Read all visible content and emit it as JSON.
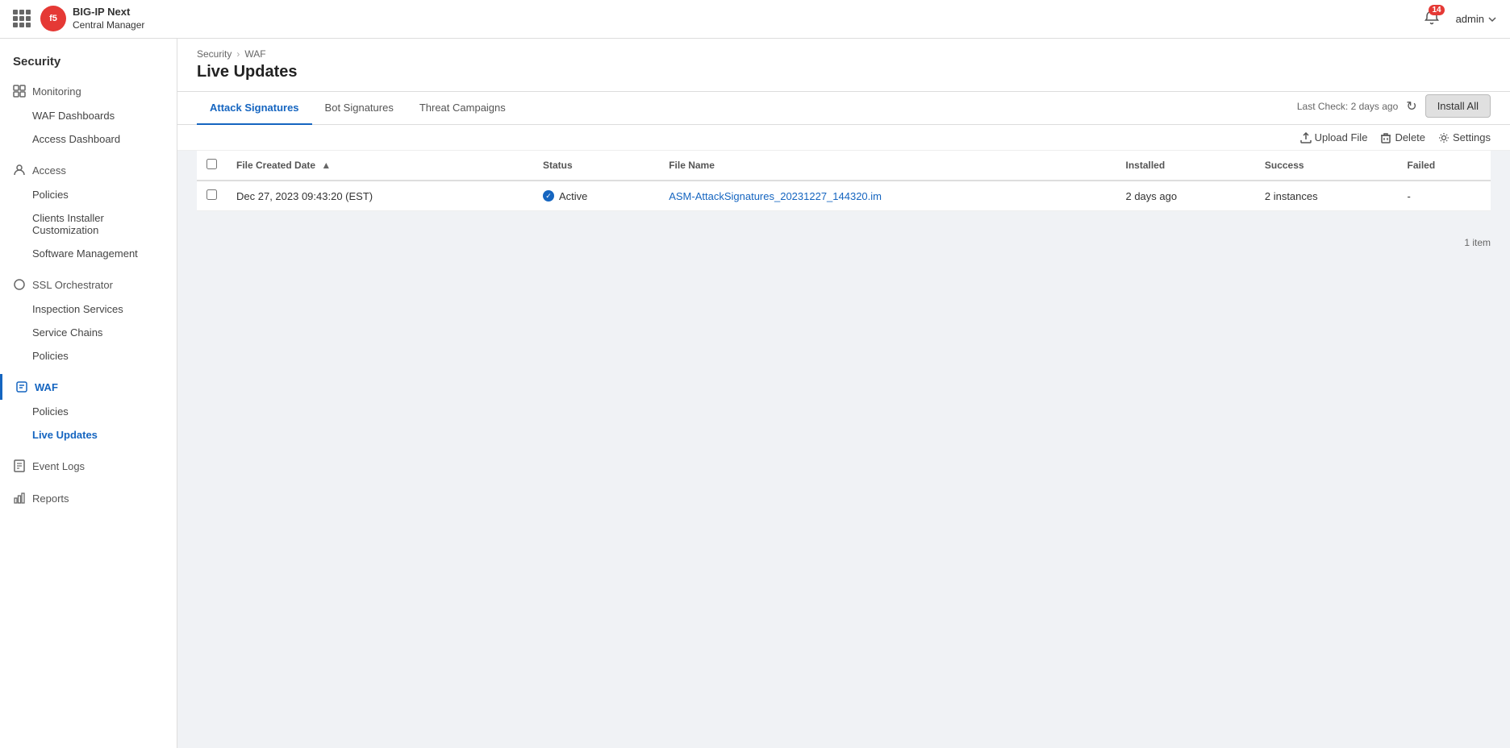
{
  "app": {
    "logo_initials": "f5",
    "product_line": "BIG-IP Next",
    "product_name": "Central Manager"
  },
  "topbar": {
    "notification_count": "14",
    "admin_label": "admin"
  },
  "sidebar": {
    "section_title": "Security",
    "groups": [
      {
        "id": "monitoring",
        "label": "Monitoring",
        "icon": "grid-icon",
        "items": [
          {
            "id": "waf-dashboards",
            "label": "WAF Dashboards"
          },
          {
            "id": "access-dashboard",
            "label": "Access Dashboard"
          }
        ]
      },
      {
        "id": "access",
        "label": "Access",
        "icon": "person-icon",
        "items": [
          {
            "id": "policies-access",
            "label": "Policies"
          },
          {
            "id": "clients-installer",
            "label": "Clients Installer Customization"
          },
          {
            "id": "software-mgmt",
            "label": "Software Management"
          }
        ]
      },
      {
        "id": "ssl-orchestrator",
        "label": "SSL Orchestrator",
        "icon": "circle-icon",
        "items": [
          {
            "id": "inspection-services",
            "label": "Inspection Services"
          },
          {
            "id": "service-chains",
            "label": "Service Chains"
          },
          {
            "id": "policies-ssl",
            "label": "Policies"
          }
        ]
      },
      {
        "id": "waf",
        "label": "WAF",
        "icon": "shield-icon",
        "active": true,
        "items": [
          {
            "id": "waf-policies",
            "label": "Policies"
          },
          {
            "id": "live-updates",
            "label": "Live Updates",
            "active": true
          }
        ]
      },
      {
        "id": "event-logs",
        "label": "Event Logs",
        "icon": "log-icon",
        "items": []
      },
      {
        "id": "reports",
        "label": "Reports",
        "icon": "report-icon",
        "items": []
      }
    ]
  },
  "breadcrumb": {
    "items": [
      "Security",
      "WAF"
    ]
  },
  "page_title": "Live Updates",
  "tabs": [
    {
      "id": "attack-signatures",
      "label": "Attack Signatures",
      "active": true
    },
    {
      "id": "bot-signatures",
      "label": "Bot Signatures"
    },
    {
      "id": "threat-campaigns",
      "label": "Threat Campaigns"
    }
  ],
  "toolbar": {
    "last_check_label": "Last Check:",
    "last_check_value": "2 days ago",
    "install_all_label": "Install All"
  },
  "actions": {
    "upload_file_label": "Upload File",
    "delete_label": "Delete",
    "settings_label": "Settings"
  },
  "table": {
    "columns": [
      {
        "id": "file-created-date",
        "label": "File Created Date",
        "sortable": true
      },
      {
        "id": "status",
        "label": "Status"
      },
      {
        "id": "file-name",
        "label": "File Name"
      },
      {
        "id": "installed",
        "label": "Installed"
      },
      {
        "id": "success",
        "label": "Success"
      },
      {
        "id": "failed",
        "label": "Failed"
      }
    ],
    "rows": [
      {
        "id": "row-1",
        "file_created_date": "Dec 27, 2023 09:43:20 (EST)",
        "status": "Active",
        "file_name": "ASM-AttackSignatures_20231227_144320.im",
        "installed": "2 days ago",
        "success": "2 instances",
        "failed": "-"
      }
    ]
  },
  "footer": {
    "item_count": "1 item"
  }
}
